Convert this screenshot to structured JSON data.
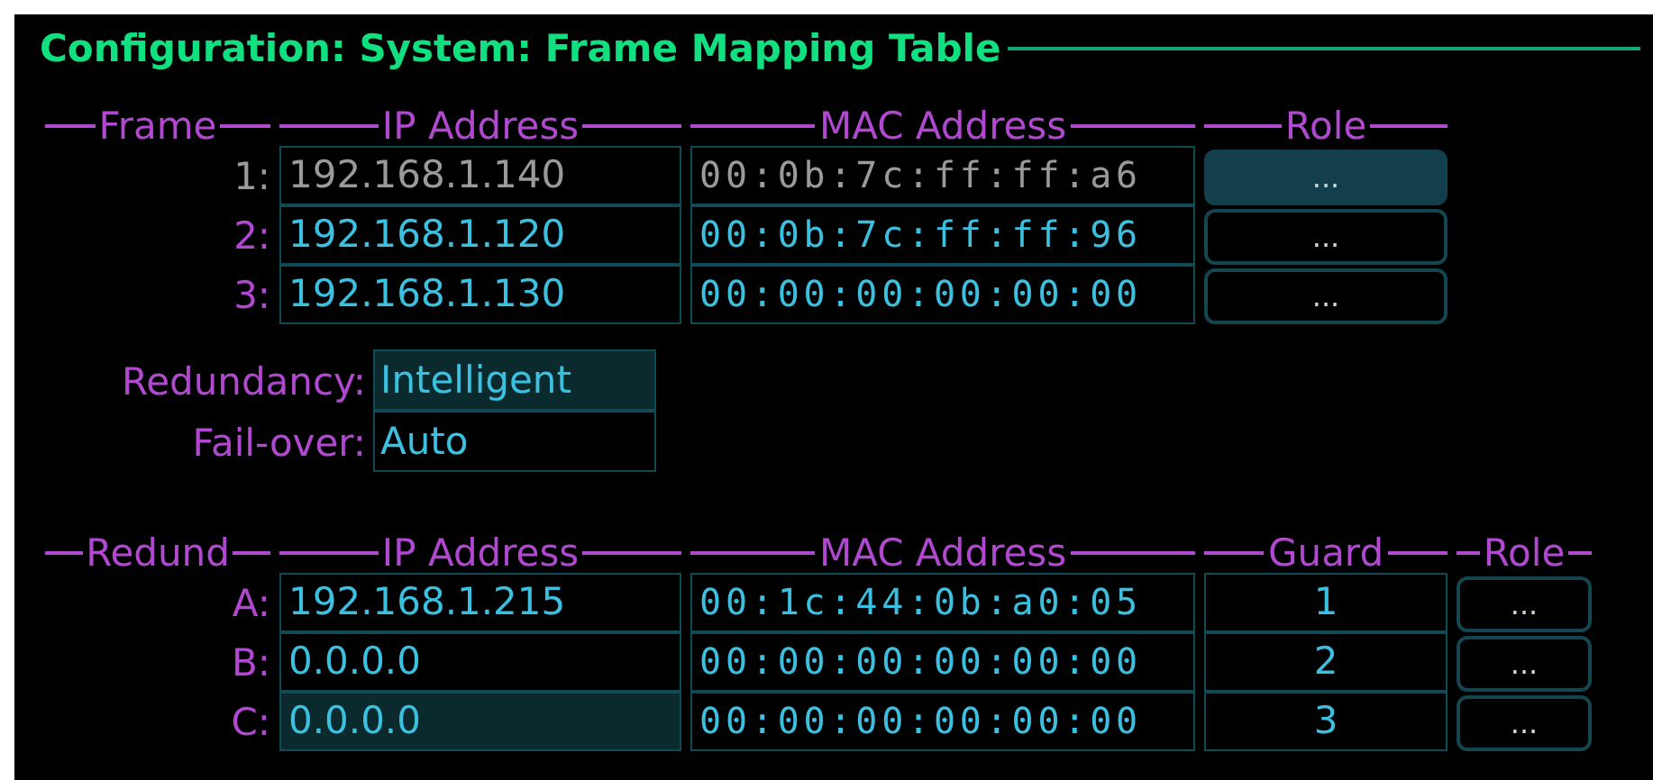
{
  "title": "Configuration: System: Frame Mapping Table",
  "frame_table": {
    "columns": [
      "Frame",
      "IP Address",
      "MAC Address",
      "Role"
    ],
    "rows": [
      {
        "label": "1:",
        "ip": "192.168.1.140",
        "mac": "00:0b:7c:ff:ff:a6",
        "role": "...",
        "disabled": true,
        "role_selected": true,
        "ip_highlighted": false
      },
      {
        "label": "2:",
        "ip": "192.168.1.120",
        "mac": "00:0b:7c:ff:ff:96",
        "role": "...",
        "disabled": false,
        "role_selected": false,
        "ip_highlighted": false
      },
      {
        "label": "3:",
        "ip": "192.168.1.130",
        "mac": "00:00:00:00:00:00",
        "role": "...",
        "disabled": false,
        "role_selected": false,
        "ip_highlighted": false
      }
    ]
  },
  "options": [
    {
      "label": "Redundancy:",
      "value": "Intelligent",
      "highlighted": true
    },
    {
      "label": "Fail-over:",
      "value": "Auto",
      "highlighted": false
    }
  ],
  "redundancy_table": {
    "columns": [
      "Redund",
      "IP Address",
      "MAC Address",
      "Guard",
      "Role"
    ],
    "rows": [
      {
        "label": "A:",
        "ip": "192.168.1.215",
        "mac": "00:1c:44:0b:a0:05",
        "guard": "1",
        "role": "...",
        "disabled": false,
        "role_selected": false,
        "ip_highlighted": false
      },
      {
        "label": "B:",
        "ip": "0.0.0.0",
        "mac": "00:00:00:00:00:00",
        "guard": "2",
        "role": "...",
        "disabled": false,
        "role_selected": false,
        "ip_highlighted": false
      },
      {
        "label": "C:",
        "ip": "0.0.0.0",
        "mac": "00:00:00:00:00:00",
        "guard": "3",
        "role": "...",
        "disabled": false,
        "role_selected": false,
        "ip_highlighted": true
      }
    ]
  }
}
